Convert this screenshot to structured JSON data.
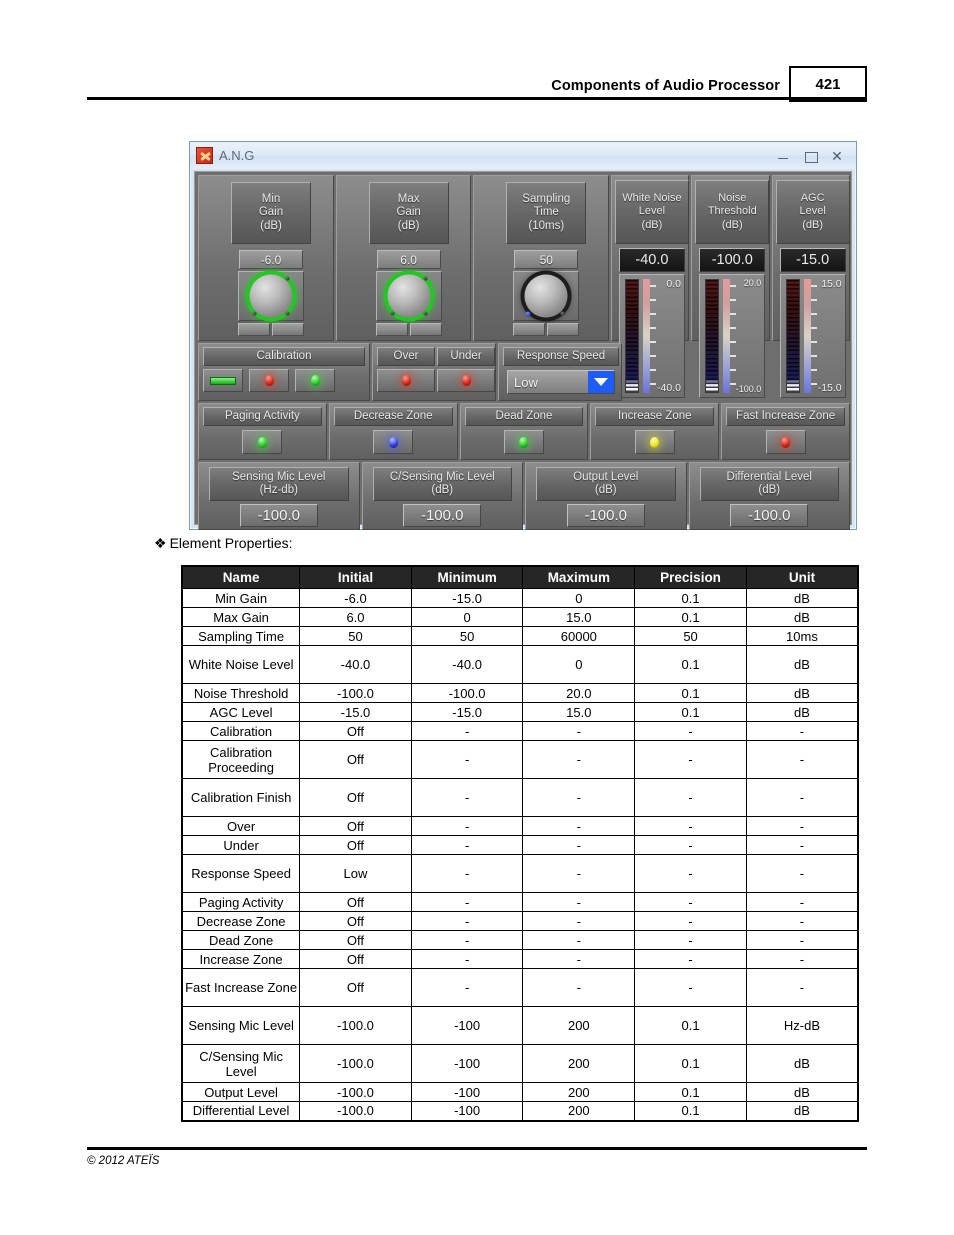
{
  "header": {
    "title": "Components of Audio Processor",
    "page_number": "421"
  },
  "window": {
    "title": "A.N.G",
    "icon": "ang-app-icon",
    "controls": {
      "minimize": "minimize-icon",
      "maximize": "maximize-icon",
      "close": "close-icon"
    },
    "knobs": [
      {
        "label_line1": "Min",
        "label_line2": "Gain",
        "label_line3": "(dB)",
        "value": "-6.0",
        "ring": "green"
      },
      {
        "label_line1": "Max",
        "label_line2": "Gain",
        "label_line3": "(dB)",
        "value": "6.0",
        "ring": "green"
      },
      {
        "label_line1": "Sampling",
        "label_line2": "Time",
        "label_line3": "(10ms)",
        "value": "50",
        "ring": "dark"
      }
    ],
    "meters": [
      {
        "label_line1": "White Noise",
        "label_line2": "Level",
        "label_line3": "(dB)",
        "value": "-40.0",
        "scale_top": "0.0",
        "scale_bottom": "-40.0"
      },
      {
        "label_line1": "Noise",
        "label_line2": "Threshold",
        "label_line3": "(dB)",
        "value": "-100.0",
        "scale_top": "20.0",
        "scale_bottom": "-100.0"
      },
      {
        "label_line1": "AGC",
        "label_line2": "Level",
        "label_line3": "(dB)",
        "value": "-15.0",
        "scale_top": "15.0",
        "scale_bottom": "-15.0"
      }
    ],
    "calibration": {
      "label": "Calibration",
      "switch_state": "on",
      "leds": [
        "red",
        "green"
      ]
    },
    "over": {
      "label": "Over",
      "led": "red"
    },
    "under": {
      "label": "Under",
      "led": "red"
    },
    "response_speed": {
      "label": "Response Speed",
      "value": "Low"
    },
    "zones": [
      {
        "label": "Paging Activity",
        "led": "green"
      },
      {
        "label": "Decrease Zone",
        "led": "blue"
      },
      {
        "label": "Dead Zone",
        "led": "green"
      },
      {
        "label": "Increase Zone",
        "led": "yellow"
      },
      {
        "label": "Fast Increase Zone",
        "led": "red"
      }
    ],
    "levels": [
      {
        "label_line1": "Sensing Mic Level",
        "label_line2": "(Hz-db)",
        "value": "-100.0"
      },
      {
        "label_line1": "C/Sensing Mic Level",
        "label_line2": "(dB)",
        "value": "-100.0"
      },
      {
        "label_line1": "Output Level",
        "label_line2": "(dB)",
        "value": "-100.0"
      },
      {
        "label_line1": "Differential Level",
        "label_line2": "(dB)",
        "value": "-100.0"
      }
    ]
  },
  "section_heading": "Element Properties:",
  "bullet_glyph": "❖",
  "table": {
    "columns": [
      "Name",
      "Initial",
      "Minimum",
      "Maximum",
      "Precision",
      "Unit"
    ],
    "rows": [
      {
        "name": "Min Gain",
        "initial": "-6.0",
        "minimum": "-15.0",
        "maximum": "0",
        "precision": "0.1",
        "unit": "dB",
        "two_line": false
      },
      {
        "name": "Max Gain",
        "initial": "6.0",
        "minimum": "0",
        "maximum": "15.0",
        "precision": "0.1",
        "unit": "dB",
        "two_line": false
      },
      {
        "name": "Sampling Time",
        "initial": "50",
        "minimum": "50",
        "maximum": "60000",
        "precision": "50",
        "unit": "10ms",
        "two_line": false
      },
      {
        "name": "White Noise Level",
        "initial": "-40.0",
        "minimum": "-40.0",
        "maximum": "0",
        "precision": "0.1",
        "unit": "dB",
        "two_line": true
      },
      {
        "name": "Noise Threshold",
        "initial": "-100.0",
        "minimum": "-100.0",
        "maximum": "20.0",
        "precision": "0.1",
        "unit": "dB",
        "two_line": false
      },
      {
        "name": "AGC Level",
        "initial": "-15.0",
        "minimum": "-15.0",
        "maximum": "15.0",
        "precision": "0.1",
        "unit": "dB",
        "two_line": false
      },
      {
        "name": "Calibration",
        "initial": "Off",
        "minimum": "-",
        "maximum": "-",
        "precision": "-",
        "unit": "-",
        "two_line": false
      },
      {
        "name": "Calibration Proceeding",
        "initial": "Off",
        "minimum": "-",
        "maximum": "-",
        "precision": "-",
        "unit": "-",
        "two_line": true
      },
      {
        "name": "Calibration Finish",
        "initial": "Off",
        "minimum": "-",
        "maximum": "-",
        "precision": "-",
        "unit": "-",
        "two_line": true
      },
      {
        "name": "Over",
        "initial": "Off",
        "minimum": "-",
        "maximum": "-",
        "precision": "-",
        "unit": "-",
        "two_line": false
      },
      {
        "name": "Under",
        "initial": "Off",
        "minimum": "-",
        "maximum": "-",
        "precision": "-",
        "unit": "-",
        "two_line": false
      },
      {
        "name": "Response Speed",
        "initial": "Low",
        "minimum": "-",
        "maximum": "-",
        "precision": "-",
        "unit": "-",
        "two_line": true
      },
      {
        "name": "Paging Activity",
        "initial": "Off",
        "minimum": "-",
        "maximum": "-",
        "precision": "-",
        "unit": "-",
        "two_line": false
      },
      {
        "name": "Decrease Zone",
        "initial": "Off",
        "minimum": "-",
        "maximum": "-",
        "precision": "-",
        "unit": "-",
        "two_line": false
      },
      {
        "name": "Dead Zone",
        "initial": "Off",
        "minimum": "-",
        "maximum": "-",
        "precision": "-",
        "unit": "-",
        "two_line": false
      },
      {
        "name": "Increase Zone",
        "initial": "Off",
        "minimum": "-",
        "maximum": "-",
        "precision": "-",
        "unit": "-",
        "two_line": false
      },
      {
        "name": "Fast Increase Zone",
        "initial": "Off",
        "minimum": "-",
        "maximum": "-",
        "precision": "-",
        "unit": "-",
        "two_line": true
      },
      {
        "name": "Sensing Mic Level",
        "initial": "-100.0",
        "minimum": "-100",
        "maximum": "200",
        "precision": "0.1",
        "unit": "Hz-dB",
        "two_line": true
      },
      {
        "name": "C/Sensing Mic Level",
        "initial": "-100.0",
        "minimum": "-100",
        "maximum": "200",
        "precision": "0.1",
        "unit": "dB",
        "two_line": true
      },
      {
        "name": "Output Level",
        "initial": "-100.0",
        "minimum": "-100",
        "maximum": "200",
        "precision": "0.1",
        "unit": "dB",
        "two_line": false
      },
      {
        "name": "Differential Level",
        "initial": "-100.0",
        "minimum": "-100",
        "maximum": "200",
        "precision": "0.1",
        "unit": "dB",
        "two_line": false
      }
    ]
  },
  "footer": {
    "copyright": "© 2012 ATEÏS"
  }
}
